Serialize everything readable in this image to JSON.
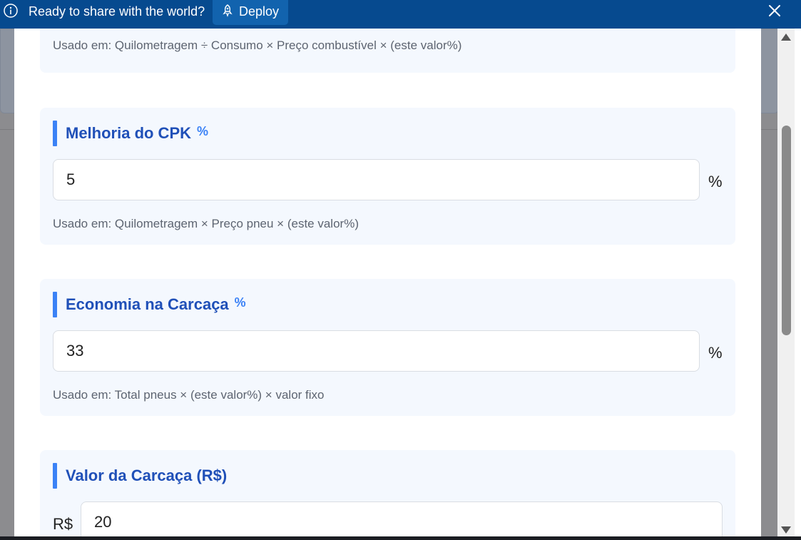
{
  "notification": {
    "message": "Ready to share with the world?",
    "deploy_label": "Deploy"
  },
  "cards": [
    {
      "help": "Usado em: Quilometragem ÷ Consumo × Preço combustível × (este valor%)"
    },
    {
      "title": "Melhoria do CPK",
      "title_icon": "%",
      "value": "5",
      "unit": "%",
      "help": "Usado em: Quilometragem × Preço pneu × (este valor%)"
    },
    {
      "title": "Economia na Carcaça",
      "title_icon": "%",
      "value": "33",
      "unit": "%",
      "help": "Usado em: Total pneus × (este valor%) × valor fixo"
    },
    {
      "title": "Valor da Carcaça (R$)",
      "value": "20",
      "prefix": "R$"
    }
  ],
  "colors": {
    "topbar": "#064a8f",
    "deploy_button": "#1263ae",
    "card_bg": "#f4f8fe",
    "accent_bar": "#3b82f6",
    "title_text": "#2050b8"
  }
}
